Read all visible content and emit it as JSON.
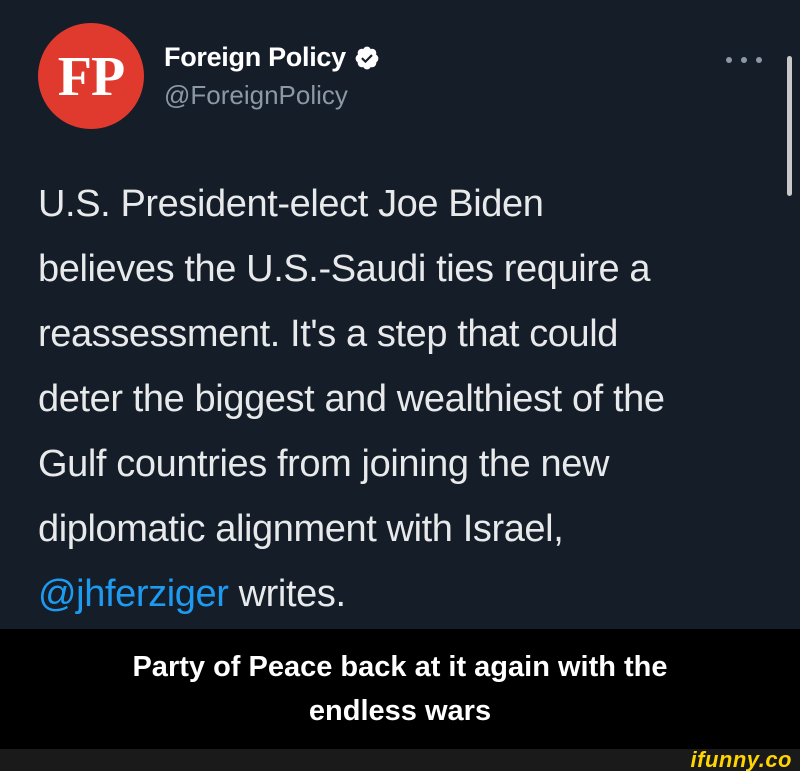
{
  "tweet": {
    "avatar_text": "FP",
    "display_name": "Foreign Policy",
    "handle": "@ForeignPolicy",
    "body_line_1": "U.S. President-elect Joe Biden",
    "body_line_2": "believes the U.S.-Saudi ties require a",
    "body_line_3": "reassessment. It's a step that could",
    "body_line_4": "deter the biggest and wealthiest of the",
    "body_line_5": "Gulf countries from joining the new",
    "body_line_6": "diplomatic alignment with Israel,",
    "mention": "@jhferziger",
    "body_end": " writes."
  },
  "icons": {
    "verified": "verified-badge-icon",
    "more": "more-options-icon"
  },
  "caption": {
    "line_1": "Party of Peace back at it again with the",
    "line_2": "endless wars"
  },
  "watermark": "ifunny.co",
  "colors": {
    "tweet_background": "#151d28",
    "avatar_red": "#e03a2e",
    "link_blue": "#1d9bf0",
    "handle_gray": "#8b98a5",
    "watermark_yellow": "#ffd400"
  }
}
